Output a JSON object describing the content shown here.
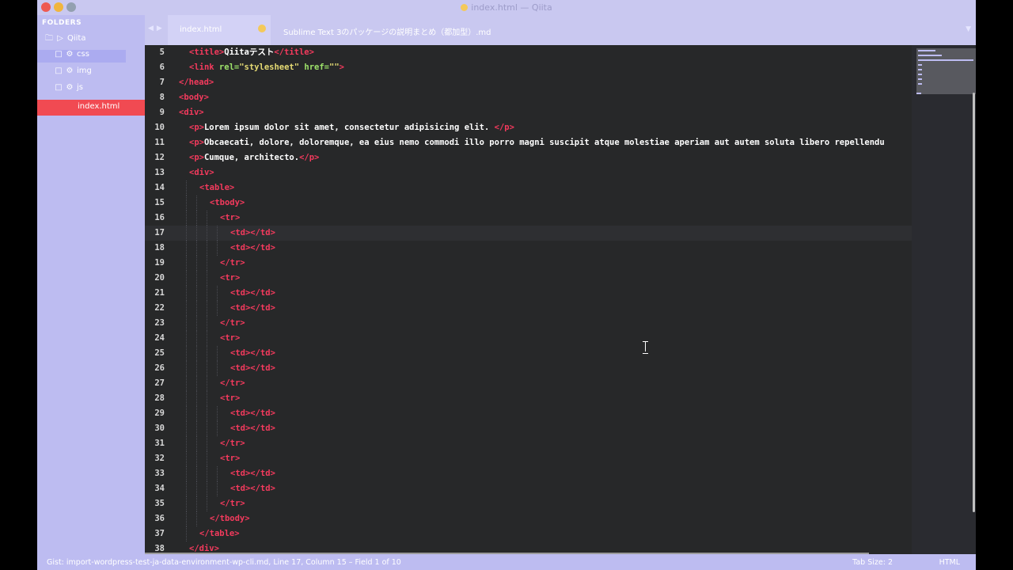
{
  "window": {
    "title": "index.html — Qiita"
  },
  "sidebar": {
    "header": "FOLDERS",
    "root": "Qiita",
    "folders": [
      "css",
      "img",
      "js"
    ],
    "active_file": "index.html"
  },
  "tabs": [
    {
      "label": "index.html",
      "modified": true
    },
    {
      "label": "Sublime Text 3のパッケージの説明まとめ（都加型）.md"
    }
  ],
  "editor": {
    "current_line": 17,
    "lines": [
      {
        "n": "5",
        "indent": 1,
        "segs": [
          [
            "t",
            "<title>"
          ],
          [
            "x",
            "Qiitaテスト"
          ],
          [
            "t",
            "</title>"
          ]
        ]
      },
      {
        "n": "6",
        "indent": 1,
        "segs": [
          [
            "t",
            "<link"
          ],
          [
            "a",
            " rel="
          ],
          [
            "s",
            "\"stylesheet\""
          ],
          [
            "a",
            " href="
          ],
          [
            "s",
            "\"\""
          ],
          [
            "t",
            ">"
          ]
        ]
      },
      {
        "n": "7",
        "indent": 0,
        "segs": [
          [
            "t",
            "</head>"
          ]
        ]
      },
      {
        "n": "8",
        "indent": 0,
        "segs": [
          [
            "t",
            "<body>"
          ]
        ]
      },
      {
        "n": "9",
        "indent": 0,
        "segs": [
          [
            "t",
            "<div>"
          ]
        ]
      },
      {
        "n": "10",
        "indent": 1,
        "segs": [
          [
            "t",
            "<p>"
          ],
          [
            "x",
            "Lorem ipsum dolor sit amet, consectetur adipisicing elit. "
          ],
          [
            "t",
            "</p>"
          ]
        ]
      },
      {
        "n": "11",
        "indent": 1,
        "segs": [
          [
            "t",
            "<p>"
          ],
          [
            "x",
            "Obcaecati, dolore, doloremque, ea eius nemo commodi illo porro magni suscipit atque molestiae aperiam aut autem soluta libero repellendu"
          ]
        ]
      },
      {
        "n": "12",
        "indent": 1,
        "segs": [
          [
            "t",
            "<p>"
          ],
          [
            "x",
            "Cumque, architecto."
          ],
          [
            "t",
            "</p>"
          ]
        ]
      },
      {
        "n": "13",
        "indent": 1,
        "segs": [
          [
            "t",
            "<div>"
          ]
        ]
      },
      {
        "n": "14",
        "indent": 2,
        "segs": [
          [
            "t",
            "<table>"
          ]
        ]
      },
      {
        "n": "15",
        "indent": 3,
        "segs": [
          [
            "t",
            "<tbody>"
          ]
        ]
      },
      {
        "n": "16",
        "indent": 4,
        "segs": [
          [
            "t",
            "<tr>"
          ]
        ]
      },
      {
        "n": "17",
        "indent": 5,
        "segs": [
          [
            "t",
            "<td></td>"
          ]
        ]
      },
      {
        "n": "18",
        "indent": 5,
        "segs": [
          [
            "t",
            "<td></td>"
          ]
        ]
      },
      {
        "n": "19",
        "indent": 4,
        "segs": [
          [
            "t",
            "</tr>"
          ]
        ]
      },
      {
        "n": "20",
        "indent": 4,
        "segs": [
          [
            "t",
            "<tr>"
          ]
        ]
      },
      {
        "n": "21",
        "indent": 5,
        "segs": [
          [
            "t",
            "<td></td>"
          ]
        ]
      },
      {
        "n": "22",
        "indent": 5,
        "segs": [
          [
            "t",
            "<td></td>"
          ]
        ]
      },
      {
        "n": "23",
        "indent": 4,
        "segs": [
          [
            "t",
            "</tr>"
          ]
        ]
      },
      {
        "n": "24",
        "indent": 4,
        "segs": [
          [
            "t",
            "<tr>"
          ]
        ]
      },
      {
        "n": "25",
        "indent": 5,
        "segs": [
          [
            "t",
            "<td></td>"
          ]
        ]
      },
      {
        "n": "26",
        "indent": 5,
        "segs": [
          [
            "t",
            "<td></td>"
          ]
        ]
      },
      {
        "n": "27",
        "indent": 4,
        "segs": [
          [
            "t",
            "</tr>"
          ]
        ]
      },
      {
        "n": "28",
        "indent": 4,
        "segs": [
          [
            "t",
            "<tr>"
          ]
        ]
      },
      {
        "n": "29",
        "indent": 5,
        "segs": [
          [
            "t",
            "<td></td>"
          ]
        ]
      },
      {
        "n": "30",
        "indent": 5,
        "segs": [
          [
            "t",
            "<td></td>"
          ]
        ]
      },
      {
        "n": "31",
        "indent": 4,
        "segs": [
          [
            "t",
            "</tr>"
          ]
        ]
      },
      {
        "n": "32",
        "indent": 4,
        "segs": [
          [
            "t",
            "<tr>"
          ]
        ]
      },
      {
        "n": "33",
        "indent": 5,
        "segs": [
          [
            "t",
            "<td></td>"
          ]
        ]
      },
      {
        "n": "34",
        "indent": 5,
        "segs": [
          [
            "t",
            "<td></td>"
          ]
        ]
      },
      {
        "n": "35",
        "indent": 4,
        "segs": [
          [
            "t",
            "</tr>"
          ]
        ]
      },
      {
        "n": "36",
        "indent": 3,
        "segs": [
          [
            "t",
            "</tbody>"
          ]
        ]
      },
      {
        "n": "37",
        "indent": 2,
        "segs": [
          [
            "t",
            "</table>"
          ]
        ]
      },
      {
        "n": "38",
        "indent": 1,
        "segs": [
          [
            "t",
            "</div>"
          ]
        ]
      }
    ]
  },
  "status": {
    "left": "Gist: import-wordpress-test-ja-data-environment-wp-cli.md, Line 17, Column 15 – Field 1 of 10",
    "tab_size": "Tab Size: 2",
    "syntax": "HTML"
  },
  "icons": {
    "folder_open": "open-folder-icon",
    "folder": "folder-icon",
    "gear": "gear-icon"
  },
  "colors": {
    "tag": "#f43a5d",
    "attribute": "#9ee36a",
    "string": "#e6db74",
    "sidebar_active": "#f14a52",
    "sidebar_bg": "#bdbcf1",
    "editor_bg": "#272829"
  }
}
